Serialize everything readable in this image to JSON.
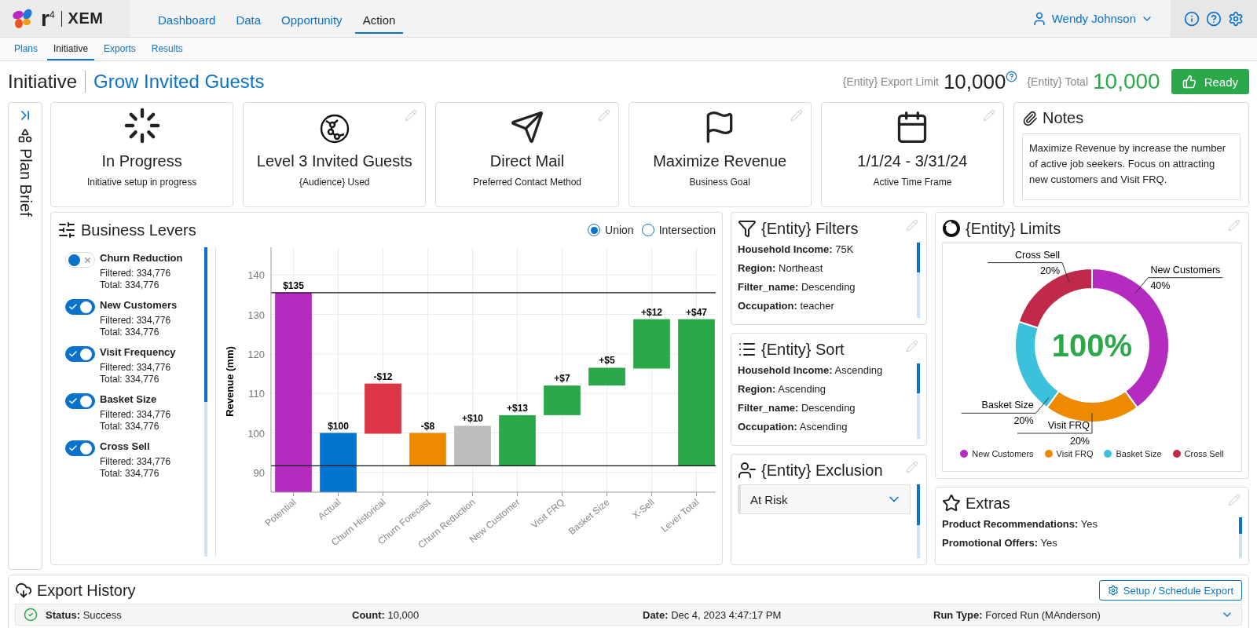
{
  "header": {
    "logo_mark": "r$^{4}$",
    "brand": "XEM",
    "nav": [
      {
        "label": "Dashboard",
        "selected": false
      },
      {
        "label": "Data",
        "selected": false
      },
      {
        "label": "Opportunity",
        "selected": false
      },
      {
        "label": "Action",
        "selected": true
      }
    ],
    "user": "Wendy Johnson"
  },
  "subnav": [
    {
      "label": "Plans",
      "selected": false
    },
    {
      "label": "Initiative",
      "selected": true
    },
    {
      "label": "Exports",
      "selected": false
    },
    {
      "label": "Results",
      "selected": false
    }
  ],
  "page": {
    "title": "Initiative",
    "name": "Grow Invited Guests",
    "export_limit_label": "{Entity} Export Limit",
    "export_limit": "10,000",
    "total_label": "{Entity} Total",
    "total": "10,000",
    "ready_button": "Ready"
  },
  "side_panel": {
    "label": "Plan Brief"
  },
  "summary_cards": [
    {
      "kind": "spinner",
      "title": "In Progress",
      "subtitle": "Initiative setup in progress",
      "editable": false
    },
    {
      "kind": "audience",
      "title": "Level 3 Invited Guests",
      "subtitle": "{Audience} Used",
      "editable": true
    },
    {
      "kind": "send",
      "title": "Direct Mail",
      "subtitle": "Preferred Contact Method",
      "editable": true
    },
    {
      "kind": "flag",
      "title": "Maximize Revenue",
      "subtitle": "Business Goal",
      "editable": true
    },
    {
      "kind": "calendar",
      "title": "1/1/24 - 3/31/24",
      "subtitle": "Active Time Frame",
      "editable": true
    }
  ],
  "notes": {
    "title": "Notes",
    "text": "Maximize Revenue by increase the number of active job seekers. Focus on attracting new customers and Visit FRQ."
  },
  "business_levers": {
    "title": "Business Levers",
    "modes": [
      {
        "label": "Union",
        "selected": true
      },
      {
        "label": "Intersection",
        "selected": false
      }
    ],
    "levers": [
      {
        "name": "Churn Reduction",
        "on": false,
        "filtered": "Filtered: 334,776",
        "total": "Total: 334,776"
      },
      {
        "name": "New Customers",
        "on": true,
        "filtered": "Filtered: 334,776",
        "total": "Total: 334,776"
      },
      {
        "name": "Visit Frequency",
        "on": true,
        "filtered": "Filtered: 334,776",
        "total": "Total: 334,776"
      },
      {
        "name": "Basket Size",
        "on": true,
        "filtered": "Filtered: 334,776",
        "total": "Total: 334,776"
      },
      {
        "name": "Cross Sell",
        "on": true,
        "filtered": "Filtered: 334,776",
        "total": "Total: 334,776"
      }
    ],
    "chart_data": {
      "type": "bar",
      "ylabel": "Revenue (mm)",
      "ylim": [
        85,
        147
      ],
      "yticks": [
        90,
        100,
        110,
        120,
        130,
        140
      ],
      "categories": [
        "Potential",
        "Actual",
        "Churn Historical",
        "Churn Forecast",
        "Churn Reduction",
        "New Customer",
        "Visit FRQ",
        "Basket Size",
        "X-Sell",
        "Lever Total"
      ],
      "grid": true,
      "series": [
        {
          "values": [
            50.5,
            15,
            12.7,
            8.3,
            10.1,
            12.8,
            7.5,
            4.5,
            12.5,
            37.1
          ],
          "base": [
            85,
            85,
            99.8,
            91.7,
            91.7,
            91.7,
            104.5,
            112,
            116.3,
            91.7
          ],
          "colors": [
            "#b62bbf",
            "#0174d0",
            "#dc3545",
            "#ee8a00",
            "#bdbdbd",
            "#2ba84a",
            "#2ba84a",
            "#2ba84a",
            "#2ba84a",
            "#2ba84a"
          ]
        }
      ],
      "value_labels": [
        "$135",
        "$100",
        "-$12",
        "-$8",
        "+$10",
        "+$13",
        "+$7",
        "+$5",
        "+$12",
        "+$47"
      ],
      "ref_lines": [
        {
          "axis": "y",
          "value": 135.5
        },
        {
          "axis": "y",
          "value": 91.7
        }
      ]
    }
  },
  "filters": {
    "title": "{Entity} Filters",
    "items": [
      {
        "key": "Household Income:",
        "value": "75K"
      },
      {
        "key": "Region:",
        "value": "Northeast"
      },
      {
        "key": "Filter_name:",
        "value": "Descending"
      },
      {
        "key": "Occupation:",
        "value": "teacher"
      }
    ]
  },
  "sort": {
    "title": "{Entity} Sort",
    "items": [
      {
        "key": "Household Income:",
        "value": "Ascending"
      },
      {
        "key": "Region:",
        "value": "Ascending"
      },
      {
        "key": "Filter_name:",
        "value": "Descending"
      },
      {
        "key": "Occupation:",
        "value": "Ascending"
      }
    ]
  },
  "exclusion": {
    "title": "{Entity} Exclusion",
    "value": "At Risk"
  },
  "limits": {
    "title": "{Entity} Limits",
    "center": "100%",
    "chart_data": {
      "type": "donut",
      "categories": [
        "New Customers",
        "Visit FRQ",
        "Basket Size",
        "Cross Sell"
      ],
      "values": [
        40,
        20,
        20,
        20
      ],
      "colors": [
        "#b62bbf",
        "#ee8a00",
        "#3bc1dc",
        "#c0294a"
      ],
      "value_labels": [
        "40%",
        "20%",
        "20%",
        "20%"
      ]
    }
  },
  "extras": {
    "title": "Extras",
    "items": [
      {
        "key": "Product Recommendations:",
        "value": "Yes"
      },
      {
        "key": "Promotional Offers:",
        "value": "Yes"
      }
    ]
  },
  "export_history": {
    "title": "Export History",
    "button": "Setup / Schedule Export",
    "rows": [
      {
        "fields": [
          {
            "key": "Status:",
            "value": "Success"
          },
          {
            "key": "Count:",
            "value": "10,000"
          },
          {
            "key": "Date:",
            "value": "Dec 4, 2023 4:47:17 PM"
          },
          {
            "key": "Run Type:",
            "value": "Forced Run (MAnderson)"
          }
        ]
      }
    ]
  }
}
